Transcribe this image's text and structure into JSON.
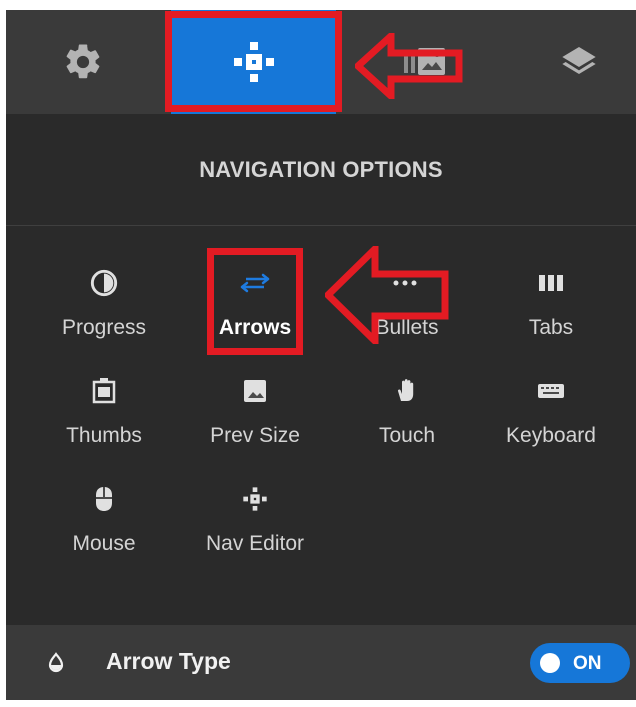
{
  "tabs": [
    {
      "icon": "gear-icon",
      "label": ""
    },
    {
      "icon": "navigation-icon",
      "label": ""
    },
    {
      "icon": "image-icon",
      "label": ""
    },
    {
      "icon": "layers-icon",
      "label": ""
    }
  ],
  "section_title": "NAVIGATION OPTIONS",
  "options": [
    {
      "label": "Progress",
      "icon": "progress-icon"
    },
    {
      "label": "Arrows",
      "icon": "arrows-icon"
    },
    {
      "label": "Bullets",
      "icon": "bullets-icon"
    },
    {
      "label": "Tabs",
      "icon": "tabs-icon"
    },
    {
      "label": "Thumbs",
      "icon": "thumbs-icon"
    },
    {
      "label": "Prev Size",
      "icon": "image-icon"
    },
    {
      "label": "Touch",
      "icon": "hand-icon"
    },
    {
      "label": "Keyboard",
      "icon": "keyboard-icon"
    },
    {
      "label": "Mouse",
      "icon": "mouse-icon"
    },
    {
      "label": "Nav Editor",
      "icon": "navigation-editor-icon"
    }
  ],
  "footer": {
    "label": "Arrow Type",
    "toggle_label": "ON",
    "icon": "drop-icon"
  },
  "colors": {
    "accent": "#1677d8",
    "annotation": "#e31b23",
    "panel_bg": "#2a2a2a",
    "header_bg": "#3a3a3a",
    "text_muted": "#d4d4d4",
    "text_white": "#ffffff"
  },
  "active_tab": "navigation-icon",
  "active_option": "Arrows"
}
